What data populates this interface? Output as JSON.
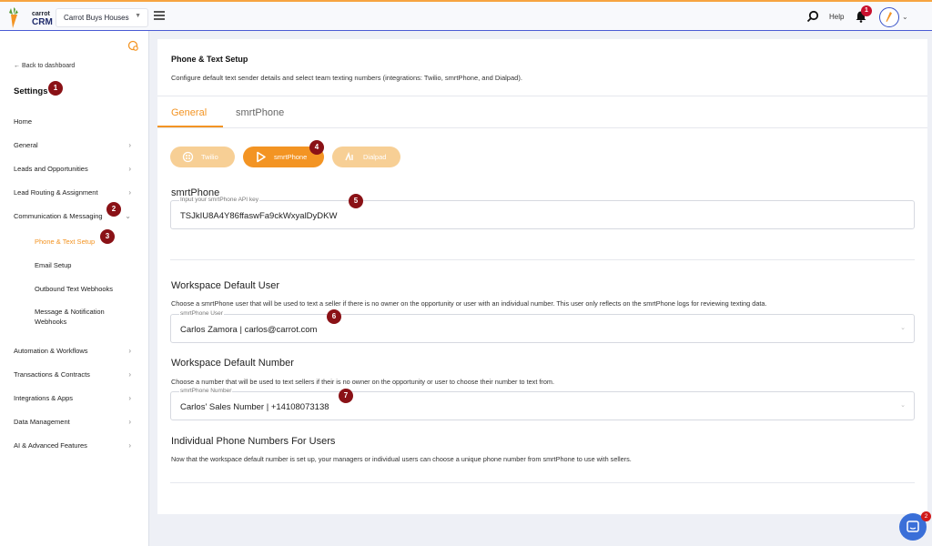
{
  "topbar": {
    "logo_small": "carrot",
    "logo_crm": "CRM",
    "business_select": "Carrot Buys Houses",
    "help_label": "Help",
    "notification_count": "1",
    "accent_color": "#f39423"
  },
  "sidebar": {
    "back_label": "Back to dashboard",
    "title": "Settings",
    "items": [
      {
        "label": "Home"
      },
      {
        "label": "General"
      },
      {
        "label": "Leads and Opportunities"
      },
      {
        "label": "Lead Routing & Assignment"
      },
      {
        "label": "Communication & Messaging"
      },
      {
        "label": "Automation & Workflows"
      },
      {
        "label": "Transactions & Contracts"
      },
      {
        "label": "Integrations & Apps"
      },
      {
        "label": "Data Management"
      },
      {
        "label": "AI & Advanced Features"
      }
    ],
    "subitems": [
      {
        "label": "Phone & Text Setup"
      },
      {
        "label": "Email Setup"
      },
      {
        "label": "Outbound Text Webhooks"
      },
      {
        "label": "Message & Notification Webhooks"
      }
    ]
  },
  "steps": [
    "1",
    "2",
    "3",
    "4",
    "5",
    "6",
    "7"
  ],
  "main": {
    "title": "Phone & Text Setup",
    "subtitle": "Configure default text sender details and select team texting numbers (integrations: Twilio, smrtPhone, and Dialpad).",
    "tabs": [
      {
        "label": "General"
      },
      {
        "label": "smrtPhone"
      }
    ],
    "providers": [
      {
        "label": "Twilio"
      },
      {
        "label": "smrtPhone"
      },
      {
        "label": "Dialpad"
      }
    ],
    "api_section": {
      "heading": "smrtPhone",
      "field_label": "Input your smrtPhone API key",
      "field_value": "TSJkIU8A4Y86ffaswFa9ckWxyalDyDKW"
    },
    "default_user": {
      "heading": "Workspace Default User",
      "description": "Choose a smrtPhone user that will be used to text a seller if there is no owner on the opportunity or user with an individual number. This user only reflects on the smrtPhone logs for reviewing texting data.",
      "field_label": "smrtPhone User",
      "field_value": "Carlos Zamora | carlos@carrot.com"
    },
    "default_number": {
      "heading": "Workspace Default Number",
      "description": "Choose a number that will be used to text sellers if their is no owner on the opportunity or user to choose their number to text from.",
      "field_label": "smrtPhone Number",
      "field_value": "Carlos' Sales Number | +14108073138"
    },
    "individual": {
      "heading": "Individual Phone Numbers For Users",
      "description": "Now that the workspace default number is set up, your managers or individual users can choose a unique phone number from smrtPhone to use with sellers."
    }
  },
  "chat": {
    "badge": "2"
  }
}
